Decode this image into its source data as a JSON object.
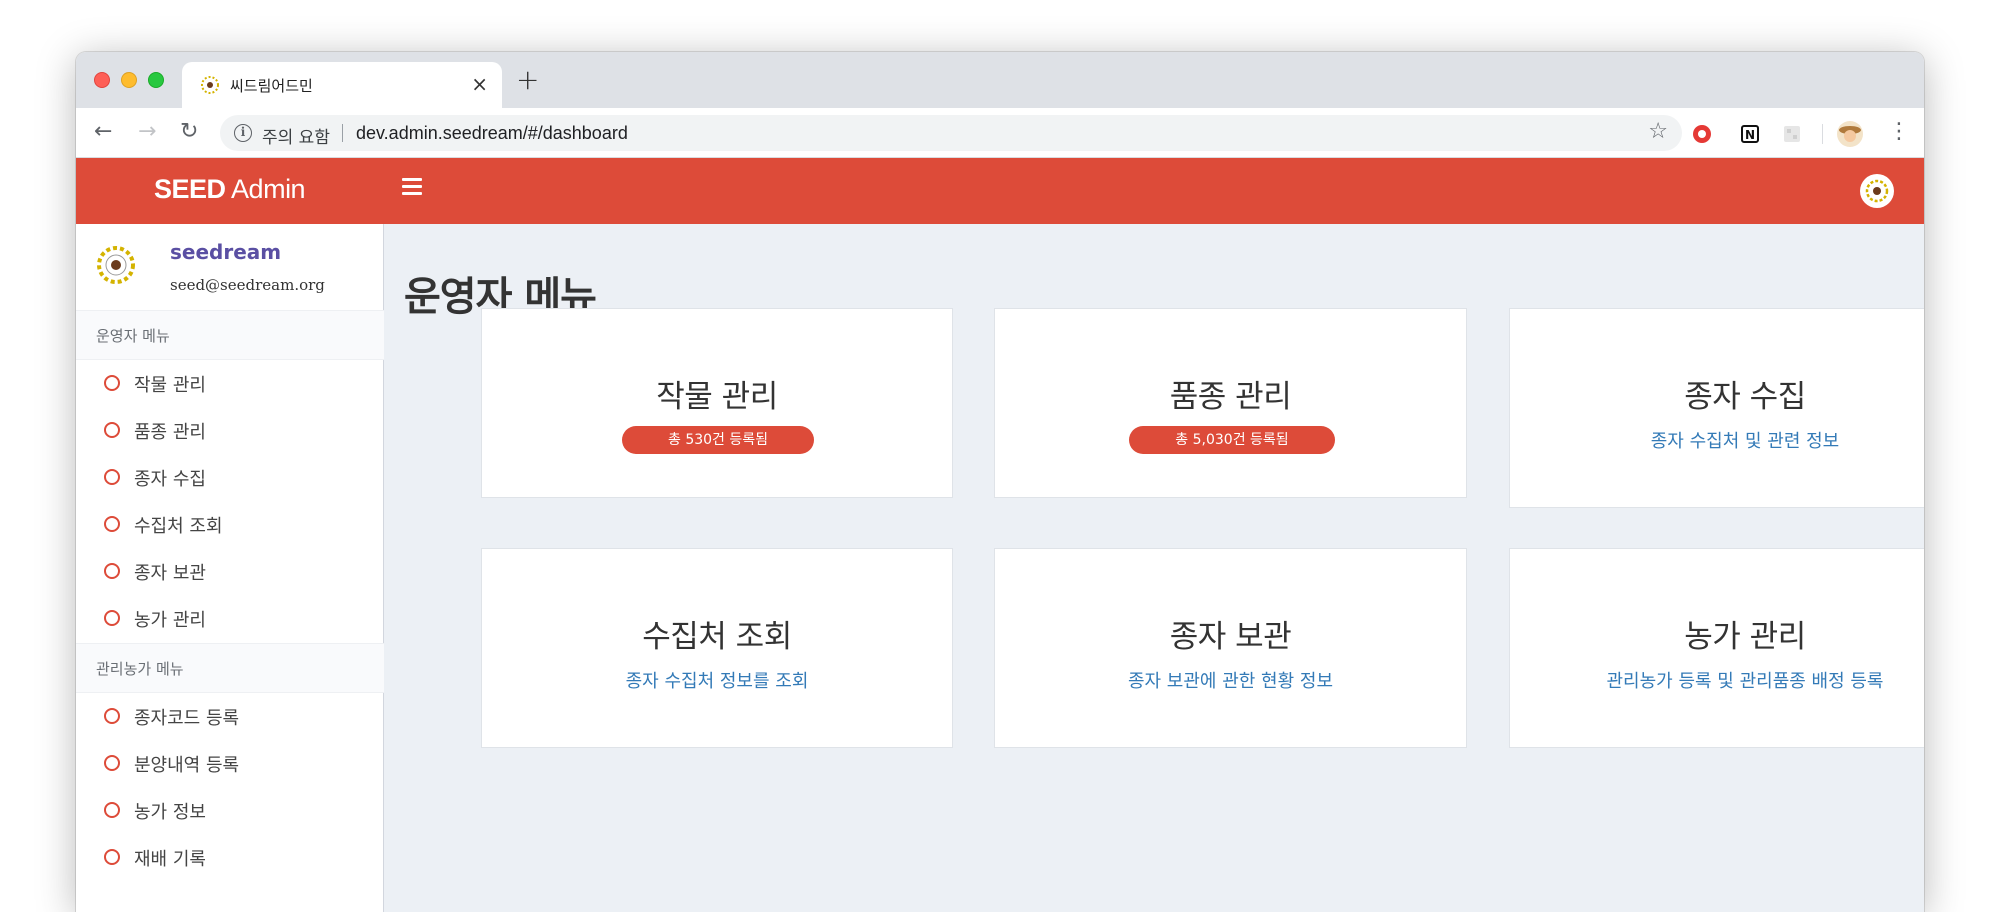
{
  "browser": {
    "tab_title": "씨드림어드민",
    "new_tab_label": "+",
    "close_label": "×",
    "security_label": "주의 요함",
    "url": "dev.admin.seedream/#/dashboard"
  },
  "header": {
    "brand_bold": "SEED",
    "brand_light": "Admin"
  },
  "user": {
    "name": "seedream",
    "email": "seed@seedream.org"
  },
  "sidebar": {
    "sections": [
      {
        "title": "운영자 메뉴",
        "items": [
          "작물 관리",
          "품종 관리",
          "종자 수집",
          "수집처 조회",
          "종자 보관",
          "농가 관리"
        ]
      },
      {
        "title": "관리농가 메뉴",
        "items": [
          "종자코드 등록",
          "분양내역 등록",
          "농가 정보",
          "재배 기록"
        ]
      }
    ]
  },
  "main": {
    "page_title": "운영자 메뉴",
    "cards": [
      {
        "title": "작물 관리",
        "badge": "총 530건 등록됨"
      },
      {
        "title": "품종 관리",
        "badge": "총 5,030건 등록됨"
      },
      {
        "title": "종자 수집",
        "description": "종자 수집처 및 관련 정보"
      },
      {
        "title": "수집처 조회",
        "description": "종자 수집처 정보를 조회"
      },
      {
        "title": "종자 보관",
        "description": "종자 보관에 관한 현황 정보"
      },
      {
        "title": "농가 관리",
        "description": "관리농가 등록 및 관리품종 배정 등록"
      }
    ]
  },
  "colors": {
    "accent": "#dd4b39",
    "link": "#337ab7",
    "content_bg": "#ecf0f5",
    "user_name": "#5a4fa3"
  },
  "icons": {
    "tab_favicon": "seed-logo-icon",
    "nav_back": "arrow-left-icon",
    "nav_forward": "arrow-right-icon",
    "reload": "reload-icon",
    "security": "info-icon",
    "bookmark": "star-icon",
    "menu_bullet": "circle-outline-icon",
    "hamburger": "hamburger-menu-icon"
  }
}
